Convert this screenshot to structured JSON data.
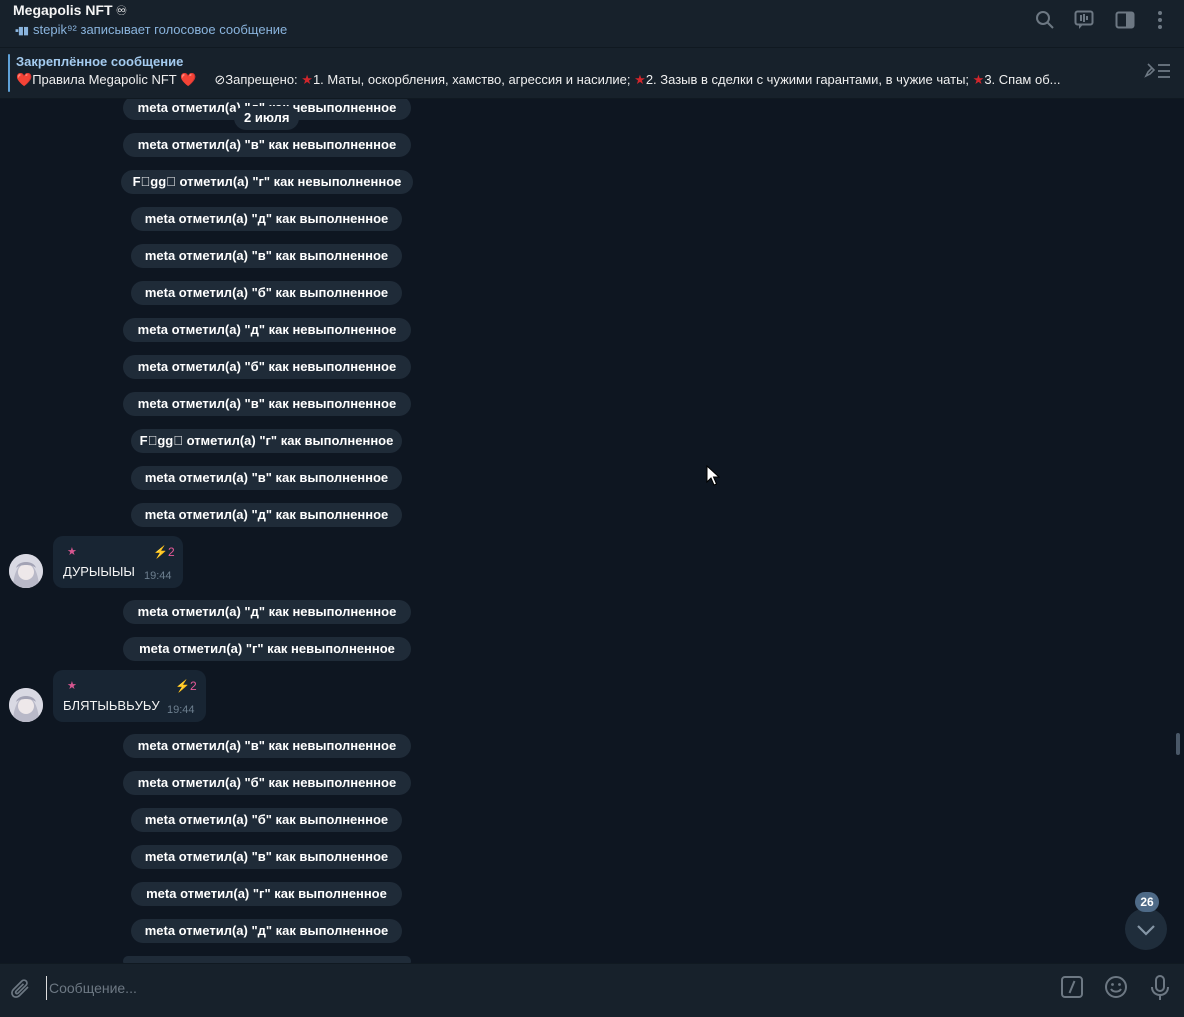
{
  "header": {
    "title": "Megapolis NFT",
    "title_emoji": "♾",
    "status": "stepik⁹² записывает голосовое сообщение",
    "icons": [
      "search-icon",
      "live-chat-icon",
      "sidebar-icon",
      "more-icon"
    ]
  },
  "pinned": {
    "title": "Закреплённое сообщение",
    "heart1": "❤️",
    "rules_label": "Правила Megapolic NFT",
    "heart2": "❤️",
    "forbidden_label": "Запрещено:",
    "rule1": "1. Маты, оскорбления, хамство, агрессия и насилие;",
    "rule2": "2. Зазыв в сделки с чужими гарантами, в чужие чаты;",
    "rule3": "3. Спам об..."
  },
  "date_chip": "2 июля",
  "service_messages": [
    "meta  отметил(а) \"д\" как невыполненное",
    "meta  отметил(а) \"в\" как невыполненное",
    "F\u0000gg\u0000  отметил(а) \"г\" как невыполненное",
    "meta отметил(а) \"д\" как выполненное",
    "meta отметил(а) \"в\" как выполненное",
    "meta отметил(а) \"б\" как выполненное",
    "meta  отметил(а) \"д\" как невыполненное",
    "meta  отметил(а) \"б\" как невыполненное",
    "meta  отметил(а) \"в\" как невыполненное",
    "F\u0000gg\u0000 отметил(а) \"г\" как выполненное",
    "meta отметил(а) \"в\" как выполненное",
    "meta отметил(а) \"д\" как выполненное",
    "meta  отметил(а) \"д\" как невыполненное",
    "meta  отметил(а) \"г\" как невыполненное",
    "meta  отметил(а) \"в\" как невыполненное",
    "meta  отметил(а) \"б\" как невыполненное",
    "meta отметил(а) \"б\" как выполненное",
    "meta отметил(а) \"в\" как выполненное",
    "meta отметил(а) \"г\" как выполненное",
    "meta отметил(а) \"д\" как выполненное"
  ],
  "messages": [
    {
      "boost": "2",
      "text": "ДУРЫЫЫЫ",
      "time": "19:44"
    },
    {
      "boost": "2",
      "text": "БЛЯТЫЬВЬУЬУ",
      "time": "19:44"
    }
  ],
  "scroll_badge": "26",
  "composer": {
    "placeholder": "Сообщение...",
    "icons": [
      "attach-icon",
      "commands-icon",
      "emoji-icon",
      "microphone-icon"
    ]
  },
  "colors": {
    "background": "#0e1621",
    "panel": "#17212b",
    "service_chip": "#1f2b38",
    "accent": "#5fa1d8",
    "boost_pink": "#e85a9a"
  }
}
